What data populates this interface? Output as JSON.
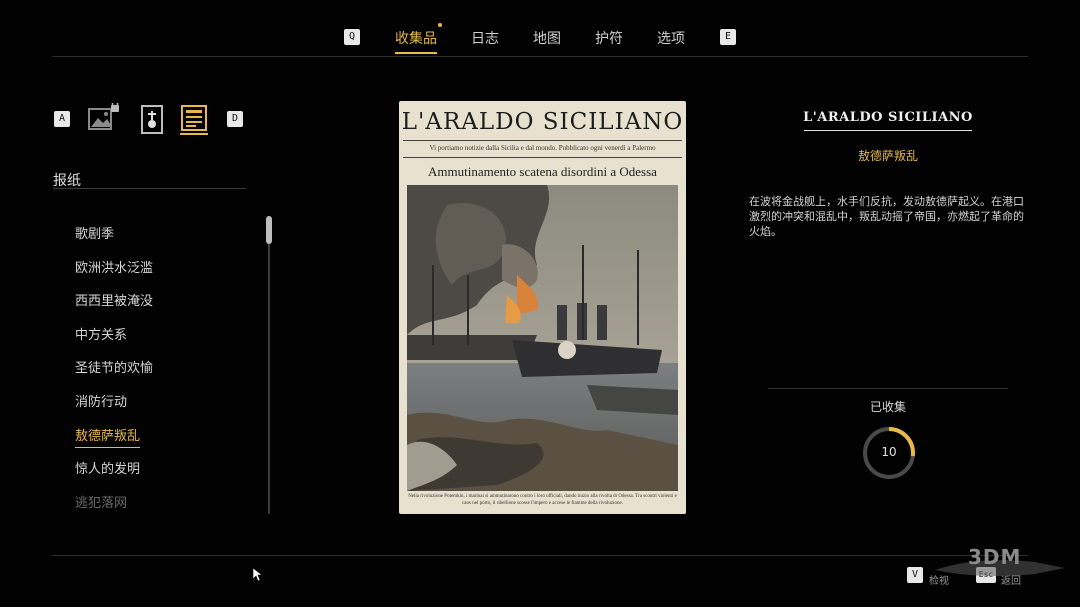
{
  "topnav": {
    "left_key": "Q",
    "right_key": "E",
    "tabs": [
      {
        "label": "收集品"
      },
      {
        "label": "日志"
      },
      {
        "label": "地图"
      },
      {
        "label": "护符"
      },
      {
        "label": "选项"
      }
    ],
    "active_tab": "收集品"
  },
  "subnav": {
    "left_key": "A",
    "right_key": "D",
    "icons": [
      "photo-locked-icon",
      "tarot-card-icon",
      "newspaper-icon"
    ]
  },
  "sidebar": {
    "title": "报纸",
    "items": [
      {
        "label": "歌剧季"
      },
      {
        "label": "欧洲洪水泛滥"
      },
      {
        "label": "西西里被淹没"
      },
      {
        "label": "中方关系"
      },
      {
        "label": "圣徒节的欢愉"
      },
      {
        "label": "消防行动"
      },
      {
        "label": "敖德萨叛乱"
      },
      {
        "label": "惊人的发明"
      },
      {
        "label": "逃犯落网"
      }
    ],
    "selected": "敖德萨叛乱"
  },
  "newspaper": {
    "masthead": "L'ARALDO SICILIANO",
    "tagline": "Vi portiamo notizie dalla Sicilia e dal mondo. Pubblicato ogni venerdì a Palermo",
    "headline": "Ammutinamento scatena disordini a Odessa",
    "caption": "Nella rivoluzione Potemkin, i marinai si ammutinarono contro i loro ufficiali, dando inizio alla rivolta di Odessa. Tra scontri violenti e caos nel porto, il ribellione scosse l'impero e accese le fiamme della rivoluzione."
  },
  "detail": {
    "title": "L'ARALDO SICILIANO",
    "subtitle": "敖德萨叛乱",
    "description": "在波将金战舰上，水手们反抗，发动敖德萨起义。在港口激烈的冲突和混乱中，叛乱动摇了帝国，亦燃起了革命的火焰。",
    "collected_label": "已收集",
    "collected_count": "10",
    "collected_fraction": 0.27
  },
  "footer": {
    "key_v": "V",
    "label_v": "检视",
    "key_esc": "Esc",
    "label_esc": "返回"
  },
  "watermark": {
    "text": "3DM"
  },
  "colors": {
    "accent": "#e8b94a",
    "background": "#020202"
  }
}
